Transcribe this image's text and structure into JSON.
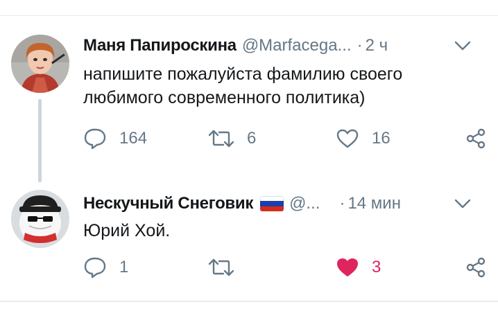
{
  "tweets": [
    {
      "author_name": "Маня Папироскина",
      "handle": "@Marfacega...",
      "separator": "·",
      "time": "2 ч",
      "text": "напишите пожалуйста фамилию своего\nлюбимого современного политика)",
      "replies": "164",
      "retweets": "6",
      "likes": "16",
      "liked": false,
      "icons": {
        "reply": "reply-icon",
        "retweet": "retweet-icon",
        "like": "heart-outline-icon",
        "share": "share-icon",
        "menu": "chevron-down-icon"
      }
    },
    {
      "author_name": "Нескучный Снеговик",
      "handle": "@...",
      "separator": "·",
      "time": "14 мин",
      "text": "Юрий Хой.",
      "replies": "1",
      "retweets": "",
      "likes": "3",
      "liked": true,
      "flag": "russia-flag-emoji",
      "icons": {
        "reply": "reply-icon",
        "retweet": "retweet-icon",
        "like": "heart-filled-icon",
        "share": "share-icon",
        "menu": "chevron-down-icon"
      }
    }
  ],
  "colors": {
    "text_primary": "#14171a",
    "text_secondary": "#657786",
    "like_active": "#e0245e",
    "thread_line": "#ccd6dd",
    "divider": "#e6ecf0"
  }
}
